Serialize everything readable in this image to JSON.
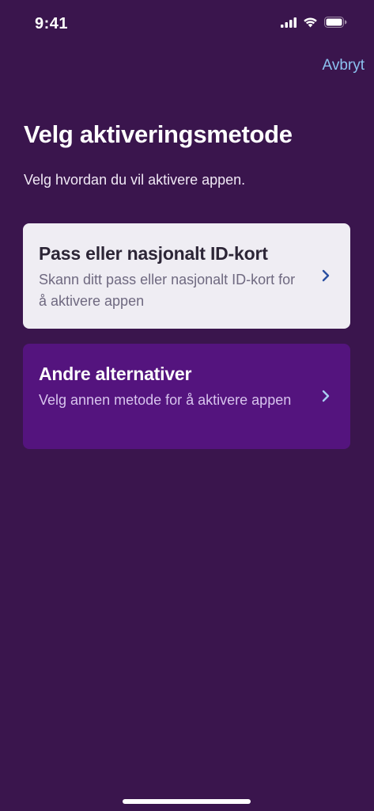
{
  "status_bar": {
    "time": "9:41"
  },
  "header": {
    "cancel_label": "Avbryt"
  },
  "main": {
    "title": "Velg aktiveringsmetode",
    "subtitle": "Velg hvordan du vil aktivere appen."
  },
  "options": [
    {
      "title": "Pass eller nasjonalt ID-kort",
      "description": "Skann ditt pass eller nasjonalt ID-kort for å aktivere appen",
      "icon": "chevron-right-icon"
    },
    {
      "title": "Andre alternativer",
      "description": "Velg annen metode for å aktivere appen",
      "icon": "chevron-right-icon"
    }
  ],
  "colors": {
    "background": "#3a154d",
    "accent_link": "#8cc2f0",
    "card_light": "#efedf3",
    "card_purple": "#54147e"
  }
}
